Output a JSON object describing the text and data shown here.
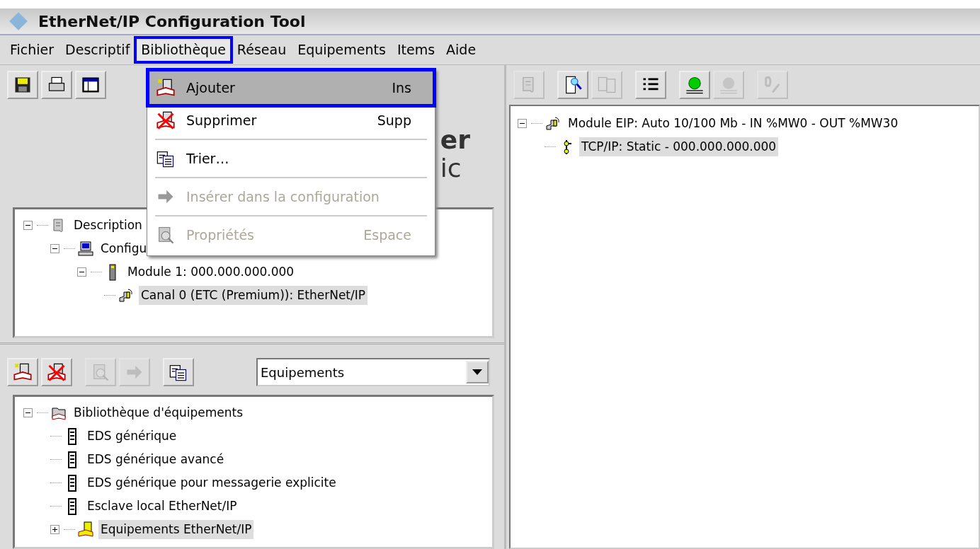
{
  "window": {
    "title": "EtherNet/IP Configuration Tool"
  },
  "menu_bar": [
    {
      "label": "Fichier",
      "selected": false
    },
    {
      "label": "Descriptif",
      "selected": false
    },
    {
      "label": "Bibliothèque",
      "selected": true
    },
    {
      "label": "Réseau",
      "selected": false
    },
    {
      "label": "Equipements",
      "selected": false
    },
    {
      "label": "Items",
      "selected": false
    },
    {
      "label": "Aide",
      "selected": false
    }
  ],
  "open_menu": {
    "items": [
      {
        "kind": "item",
        "label": "Ajouter",
        "shortcut": "Ins",
        "selected": true,
        "disabled": false
      },
      {
        "kind": "item",
        "label": "Supprimer",
        "shortcut": "Supp",
        "selected": false,
        "disabled": false
      },
      {
        "kind": "separator"
      },
      {
        "kind": "item",
        "label": "Trier…",
        "selected": false,
        "disabled": false
      },
      {
        "kind": "separator"
      },
      {
        "kind": "item",
        "label": "Insérer dans la configuration",
        "selected": false,
        "disabled": true
      },
      {
        "kind": "separator"
      },
      {
        "kind": "item",
        "label": "Propriétés",
        "shortcut": "Espace",
        "selected": false,
        "disabled": true
      }
    ]
  },
  "left_toolbar": [
    {
      "disabled": false
    },
    {
      "disabled": false
    },
    {
      "disabled": false
    }
  ],
  "logo_fragments": [
    "er",
    "ic"
  ],
  "config_tree": [
    {
      "label": "Description",
      "expanded": true,
      "selected": false,
      "children": [
        {
          "label": "Configu",
          "expanded": true,
          "selected": false,
          "children": [
            {
              "label": "Module 1:  000.000.000.000",
              "expanded": true,
              "selected": false,
              "children": [
                {
                  "label": "Canal 0 (ETC (Premium)): EtherNet/IP",
                  "selected": true
                }
              ]
            }
          ]
        }
      ]
    }
  ],
  "library_toolbar": [
    {
      "disabled": false
    },
    {
      "disabled": false
    },
    {
      "disabled": true
    },
    {
      "disabled": true
    },
    {
      "disabled": false
    }
  ],
  "library_filter": {
    "value": "Equipements"
  },
  "library_tree": [
    {
      "label": "Bibliothèque d'équipements",
      "expanded": true,
      "selected": false,
      "children": [
        {
          "label": "EDS générique",
          "selected": false
        },
        {
          "label": "EDS générique avancé",
          "selected": false
        },
        {
          "label": "EDS générique pour messagerie explicite",
          "selected": false
        },
        {
          "label": "Esclave local EtherNet/IP",
          "selected": false
        },
        {
          "label": "Equipements EtherNet/IP",
          "expanded": false,
          "selected": true
        }
      ]
    }
  ],
  "right_toolbar": [
    {
      "disabled": true
    },
    {
      "disabled": false
    },
    {
      "disabled": true
    },
    {
      "disabled": false
    },
    {
      "disabled": false
    },
    {
      "disabled": true
    },
    {
      "disabled": true
    }
  ],
  "network_tree": [
    {
      "label": "Module EIP: Auto 10/100 Mb - IN %MW0 - OUT %MW30",
      "expanded": true,
      "selected": false,
      "children": [
        {
          "label": "TCP/IP: Static - 000.000.000.000",
          "selected": true
        }
      ]
    }
  ]
}
